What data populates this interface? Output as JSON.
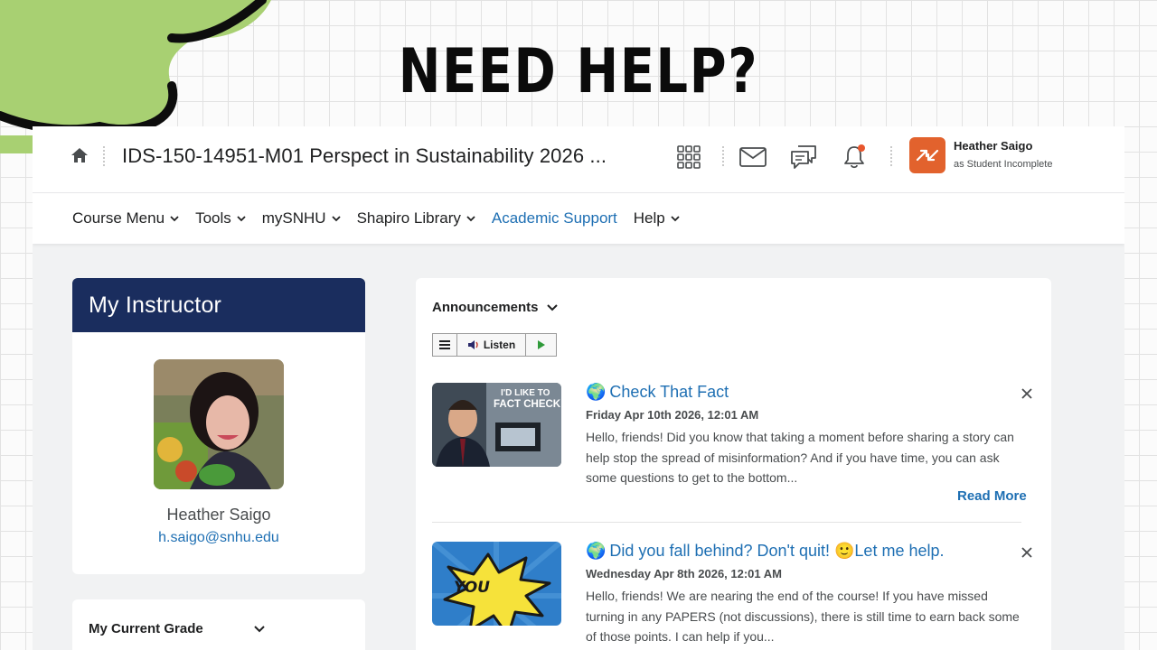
{
  "overlay": {
    "headline": "NEED HELP?"
  },
  "topbar": {
    "course_title": "IDS-150-14951-M01 Perspect in Sustainability 2026 ...",
    "icons": [
      "home-icon",
      "waffle-grid-icon",
      "mail-icon",
      "chat-icon",
      "bell-icon"
    ],
    "notification_color": "#e8562d",
    "user": {
      "name": "Heather Saigo",
      "role": "as Student Incomplete",
      "avatar_color": "#e2622d"
    }
  },
  "navbar": {
    "items": [
      {
        "label": "Course Menu",
        "dropdown": true
      },
      {
        "label": "Tools",
        "dropdown": true
      },
      {
        "label": "mySNHU",
        "dropdown": true
      },
      {
        "label": "Shapiro Library",
        "dropdown": true
      },
      {
        "label": "Academic Support",
        "dropdown": false
      },
      {
        "label": "Help",
        "dropdown": true
      }
    ]
  },
  "instructor": {
    "header": "My Instructor",
    "name": "Heather Saigo",
    "email": "h.saigo@snhu.edu",
    "header_color": "#1a2d5e"
  },
  "grade": {
    "label": "My Current Grade"
  },
  "announcements": {
    "title": "Announcements",
    "listen_label": "Listen",
    "read_more": "Read More",
    "items": [
      {
        "emoji": "🌍",
        "title": "Check That Fact",
        "date": "Friday Apr 10th 2026, 12:01 AM",
        "body": "Hello, friends! Did you know that taking a moment before sharing a story can help stop the spread of misinformation? And if you have time, you can ask some questions to get to the bottom...",
        "thumb_text_1": "I'D LIKE TO",
        "thumb_text_2": "FACT CHECK"
      },
      {
        "emoji": "🌍",
        "title": "Did you fall behind? Don't quit! 🙂Let me help.",
        "date": "Wednesday Apr 8th 2026, 12:01 AM",
        "body": "Hello, friends! We are nearing the end of the course! If you have missed turning in any PAPERS (not discussions), there is still time to earn back some of those points. I can help if you...",
        "thumb_text_1": "YOU"
      }
    ]
  },
  "colors": {
    "link_blue": "#1e6fb3",
    "blob_green": "#a8d072"
  }
}
